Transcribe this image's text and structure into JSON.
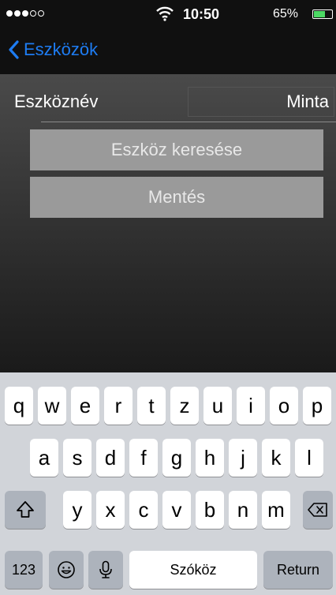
{
  "status": {
    "time": "10:50",
    "battery": "65%",
    "battery_level": 0.65
  },
  "nav": {
    "back_label": "Eszközök"
  },
  "form": {
    "name_label": "Eszköznév",
    "name_value": "Minta",
    "search_button": "Eszköz keresése",
    "save_button": "Mentés"
  },
  "keyboard": {
    "row1": [
      "q",
      "w",
      "e",
      "r",
      "t",
      "z",
      "u",
      "i",
      "o",
      "p"
    ],
    "row2": [
      "a",
      "s",
      "d",
      "f",
      "g",
      "h",
      "j",
      "k",
      "l"
    ],
    "row3": [
      "y",
      "x",
      "c",
      "v",
      "b",
      "n",
      "m"
    ],
    "numbers_key": "123",
    "space_key": "Szóköz",
    "return_key": "Return"
  },
  "icons": {
    "back": "chevron-left-icon",
    "shift": "shift-icon",
    "delete": "backspace-icon",
    "emoji": "emoji-icon",
    "mic": "microphone-icon"
  },
  "colors": {
    "accent": "#1e7cf2",
    "button": "#9a9a9a",
    "keyboard_bg": "#d1d4d9"
  }
}
